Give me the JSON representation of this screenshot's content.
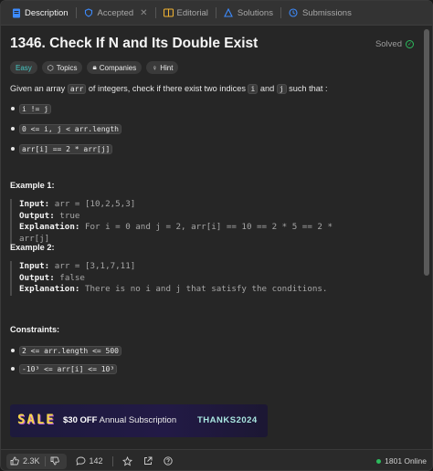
{
  "tabs": [
    {
      "label": "Description",
      "icon": "description-icon"
    },
    {
      "label": "Accepted",
      "icon": "accepted-icon"
    },
    {
      "label": "Editorial",
      "icon": "editorial-icon"
    },
    {
      "label": "Solutions",
      "icon": "solutions-icon"
    },
    {
      "label": "Submissions",
      "icon": "submissions-icon"
    }
  ],
  "problem": {
    "title": "1346. Check If N and Its Double Exist",
    "status": "Solved",
    "tags": [
      "Easy",
      "Topics",
      "Companies",
      "Hint"
    ],
    "intro_before": "Given an array ",
    "intro_code1": "arr",
    "intro_mid": " of integers, check if there exist two indices ",
    "intro_code2": "i",
    "intro_and": " and ",
    "intro_code3": "j",
    "intro_after": " such that :",
    "conditions": [
      "i != j",
      "0 <= i, j < arr.length",
      "arr[i] == 2 * arr[j]"
    ]
  },
  "examples": [
    {
      "heading": "Example 1:",
      "input_label": "Input:",
      "input": "arr = [10,2,5,3]",
      "output_label": "Output:",
      "output": "true",
      "explanation_label": "Explanation:",
      "explanation": "For i = 0 and j = 2, arr[i] == 10 == 2 * 5 == 2 * arr[j]"
    },
    {
      "heading": "Example 2:",
      "input_label": "Input:",
      "input": "arr = [3,1,7,11]",
      "output_label": "Output:",
      "output": "false",
      "explanation_label": "Explanation:",
      "explanation": "There is no i and j that satisfy the conditions."
    }
  ],
  "constraints": {
    "heading": "Constraints:",
    "items": [
      "2 <= arr.length <= 500",
      "-10³ <= arr[i] <= 10³"
    ]
  },
  "banner": {
    "sale": "SALE",
    "offer_bold": "$30 OFF",
    "offer_rest": " Annual Subscription",
    "code": "THANKS2024"
  },
  "footer": {
    "likes": "2.3K",
    "comments": "142",
    "online": "1801 Online"
  },
  "colors": {
    "accent_green": "#2cbb5d",
    "easy": "#46c6c2",
    "sale_yellow": "#f7d74a"
  }
}
